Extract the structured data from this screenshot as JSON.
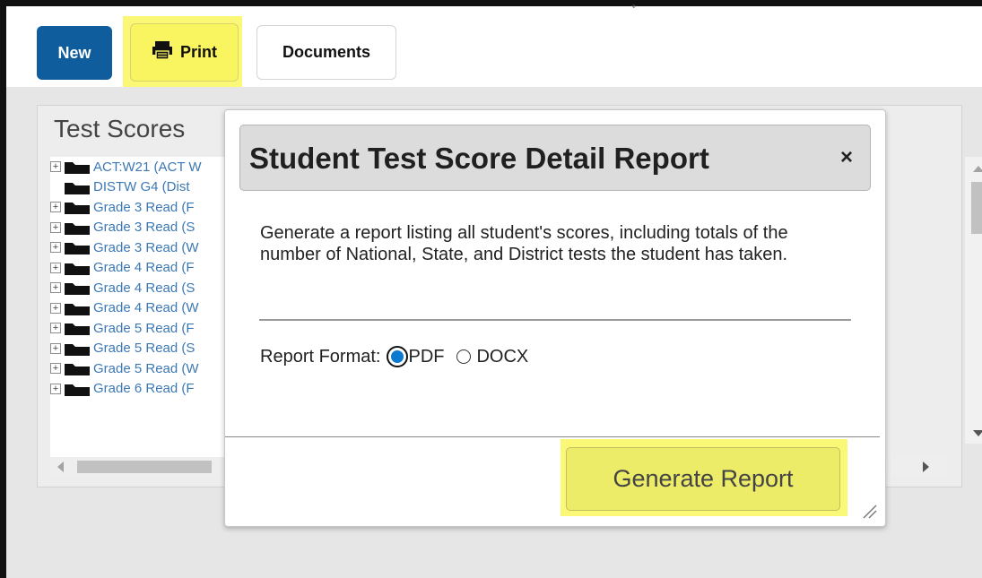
{
  "toolbar": {
    "new_label": "New",
    "print_label": "Print",
    "documents_label": "Documents"
  },
  "panel": {
    "title": "Test Scores",
    "items": [
      {
        "label": "ACT:W21 (ACT W",
        "expandable": true
      },
      {
        "label": "DISTW G4 (Dist",
        "expandable": false
      },
      {
        "label": "Grade 3 Read (F",
        "expandable": true
      },
      {
        "label": "Grade 3 Read (S",
        "expandable": true
      },
      {
        "label": "Grade 3 Read (W",
        "expandable": true
      },
      {
        "label": "Grade 4 Read (F",
        "expandable": true
      },
      {
        "label": "Grade 4 Read (S",
        "expandable": true
      },
      {
        "label": "Grade 4 Read (W",
        "expandable": true
      },
      {
        "label": "Grade 5 Read (F",
        "expandable": true
      },
      {
        "label": "Grade 5 Read (S",
        "expandable": true
      },
      {
        "label": "Grade 5 Read (W",
        "expandable": true
      },
      {
        "label": "Grade 6 Read (F",
        "expandable": true
      }
    ]
  },
  "dialog": {
    "title": "Student Test Score Detail Report",
    "close_glyph": "×",
    "description": "Generate a report listing all student's scores, including totals of the number of National, State, and District tests the student has taken.",
    "format_label": "Report Format:",
    "format_options": [
      "PDF",
      "DOCX"
    ],
    "selected_format": "PDF",
    "generate_label": "Generate Report"
  },
  "colors": {
    "primary": "#0f5d9c",
    "highlight": "#f9f561",
    "link": "#3c78b4"
  },
  "icons": [
    "printer-icon",
    "folder-icon",
    "expand-icon",
    "close-icon",
    "resize-handle-icon"
  ]
}
